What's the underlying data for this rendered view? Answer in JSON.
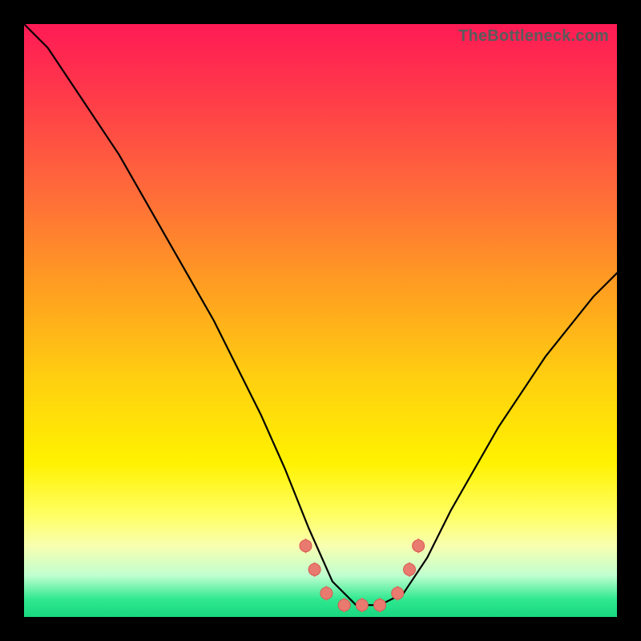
{
  "watermark": "TheBottleneck.com",
  "colors": {
    "frame": "#000000",
    "curve": "#000000",
    "point": "#e97a70",
    "gradient_top": "#ff1a55",
    "gradient_bottom": "#18d880"
  },
  "chart_data": {
    "type": "line",
    "title": "",
    "xlabel": "",
    "ylabel": "",
    "xlim": [
      0,
      100
    ],
    "ylim": [
      0,
      100
    ],
    "grid": false,
    "legend": false,
    "annotations": [],
    "series": [
      {
        "name": "bottleneck-curve",
        "x": [
          0,
          4,
          8,
          12,
          16,
          20,
          24,
          28,
          32,
          36,
          40,
          44,
          48,
          52,
          56,
          60,
          64,
          68,
          72,
          76,
          80,
          84,
          88,
          92,
          96,
          100
        ],
        "values": [
          100,
          96,
          90,
          84,
          78,
          71,
          64,
          57,
          50,
          42,
          34,
          25,
          15,
          6,
          2,
          2,
          4,
          10,
          18,
          25,
          32,
          38,
          44,
          49,
          54,
          58
        ]
      }
    ],
    "points": {
      "name": "highlighted-points",
      "x": [
        47.5,
        49,
        51,
        54,
        57,
        60,
        63,
        65,
        66.5
      ],
      "values": [
        12,
        8,
        4,
        2,
        2,
        2,
        4,
        8,
        12
      ]
    }
  }
}
